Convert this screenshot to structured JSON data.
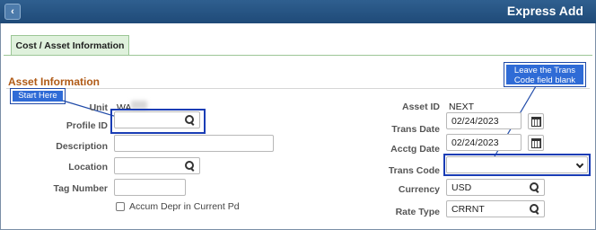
{
  "header": {
    "title": "Express Add",
    "back_icon": "chevron-left-icon"
  },
  "tabs": [
    {
      "label": "Cost / Asset Information",
      "active": true
    }
  ],
  "section": {
    "title": "Asset Information"
  },
  "annotations": {
    "start_here": "Start Here",
    "trans_code_note_line1": "Leave the Trans",
    "trans_code_note_line2": "Code field blank"
  },
  "left_fields": {
    "unit": {
      "label": "Unit",
      "value": "WA"
    },
    "profile_id": {
      "label": "Profile ID",
      "value": ""
    },
    "description": {
      "label": "Description",
      "value": ""
    },
    "location": {
      "label": "Location",
      "value": ""
    },
    "tag_number": {
      "label": "Tag Number",
      "value": ""
    },
    "accum_depr": {
      "label": "Accum Depr in Current Pd",
      "checked": false
    }
  },
  "right_fields": {
    "asset_id": {
      "label": "Asset ID",
      "value": "NEXT"
    },
    "trans_date": {
      "label": "Trans Date",
      "value": "02/24/2023"
    },
    "acctg_date": {
      "label": "Acctg Date",
      "value": "02/24/2023"
    },
    "trans_code": {
      "label": "Trans Code",
      "value": ""
    },
    "currency": {
      "label": "Currency",
      "value": "USD"
    },
    "rate_type": {
      "label": "Rate Type",
      "value": "CRRNT"
    }
  },
  "colors": {
    "accent": "#1f4a78",
    "tab_bg": "#dff1dc",
    "section_title": "#b05a16",
    "callout": "#2f6bd6"
  }
}
